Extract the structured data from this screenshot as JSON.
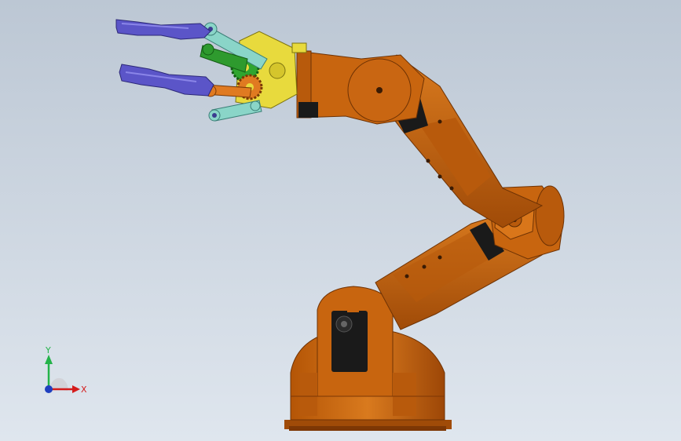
{
  "viewport": {
    "title": "",
    "background_top": "#bcc7d4",
    "background_bottom": "#dfe6ee"
  },
  "triad": {
    "x_label": "X",
    "y_label": "Y",
    "x_color": "#d41c1c",
    "y_color": "#24b34a",
    "z_color": "#1f3fbf"
  },
  "model": {
    "name": "",
    "base_color": "#c8650f",
    "arm_color": "#d06b12",
    "dark_panel_color": "#1a1a1a",
    "gripper_bracket_color": "#e8da3d",
    "finger_color": "#5b55c8",
    "link_color_teal": "#8ad5c8",
    "link_color_green": "#2e9a2e",
    "gear_color_green": "#2fa52f",
    "gear_color_orange": "#e07a21"
  }
}
